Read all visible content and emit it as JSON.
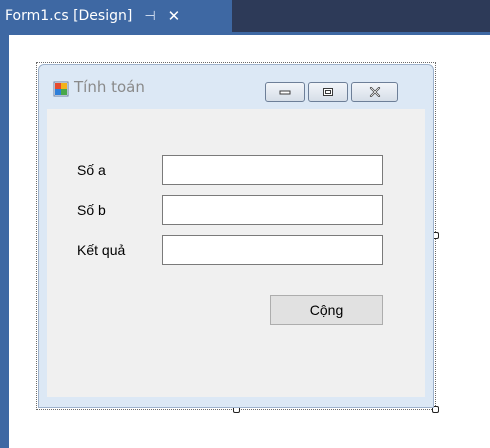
{
  "ide": {
    "tab_title": "Form1.cs [Design]",
    "pin_glyph": "⊣",
    "close_glyph": "✕"
  },
  "form": {
    "title": "Tính toán",
    "caption_buttons": [
      "minimize",
      "maximize",
      "close"
    ],
    "fields": [
      {
        "label": "Số a",
        "value": ""
      },
      {
        "label": "Số b",
        "value": ""
      },
      {
        "label": "Kết quả",
        "value": ""
      }
    ],
    "button_label": "Cộng"
  },
  "colors": {
    "ide_bar": "#2d3a58",
    "tab_active": "#3e68a3",
    "form_frame": "#dce8f5",
    "client_bg": "#f0f0f0"
  }
}
